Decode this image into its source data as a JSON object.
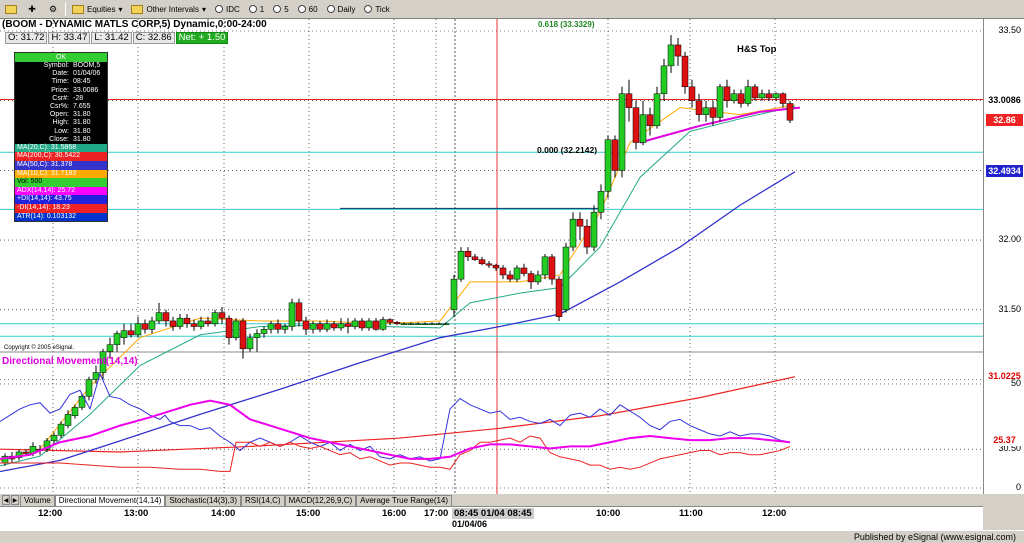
{
  "toolbar": {
    "equities": "Equities",
    "other_intervals": "Other Intervals",
    "idc": "IDC",
    "i1": "1",
    "i5": "5",
    "i60": "60",
    "daily": "Daily",
    "tick": "Tick"
  },
  "chart": {
    "title": "(BOOM - DYNAMIC MATLS CORP,5) Dynamic,0:00-24:00",
    "ohlc": {
      "open": "O: 31.72",
      "high": "H: 33.47",
      "low": "L: 31.42",
      "close": "C: 32.86",
      "net": "Net: + 1.50"
    },
    "fib_label": "0.618 (33.3329)",
    "zero_label": "0.000 (32.2142)",
    "pattern_label": "H&S Top",
    "copyright": "Copyright © 2005 eSignal.",
    "indicator_title": "Directional Movement(14,14)"
  },
  "data_box": {
    "ok": "OK",
    "rows": [
      {
        "label": "Symbol:",
        "value": "BOOM,5"
      },
      {
        "label": "Date:",
        "value": "01/04/06"
      },
      {
        "label": "Time:",
        "value": "08:45"
      },
      {
        "label": "Price:",
        "value": "33.0086"
      },
      {
        "label": "Csr#:",
        "value": "-28"
      },
      {
        "label": "Csr%:",
        "value": "7.655"
      },
      {
        "label": "Open:",
        "value": "31.80"
      },
      {
        "label": "High:",
        "value": "31.80"
      },
      {
        "label": "Low:",
        "value": "31.80"
      },
      {
        "label": "Close:",
        "value": "31.80"
      }
    ],
    "study_rows": [
      {
        "text": "MA(20,C): 31.5868",
        "bg": "#22aa88",
        "fg": "#fff"
      },
      {
        "text": "MA(200,C): 30.5422",
        "bg": "#ee2222",
        "fg": "#fff"
      },
      {
        "text": "MA(50,C): 31.378",
        "bg": "#3333cc",
        "fg": "#fff"
      },
      {
        "text": "MA(10,C): 31.7183",
        "bg": "#ffaa00",
        "fg": "#fff"
      },
      {
        "text": "Vol: 500",
        "bg": "#33cc33",
        "fg": "#000"
      },
      {
        "text": "ADX(14,14): 25.72",
        "bg": "#ff00ff",
        "fg": "#fff"
      },
      {
        "text": "+DI(14,14): 43.75",
        "bg": "#2222dd",
        "fg": "#fff"
      },
      {
        "text": "-DI(14,14): 18.23",
        "bg": "#ee2222",
        "fg": "#fff"
      },
      {
        "text": "ATR(14): 0.103132",
        "bg": "#0033cc",
        "fg": "#fff"
      }
    ]
  },
  "price_axis": {
    "labels": [
      "33.50",
      "33.00",
      "32.50",
      "32.00",
      "31.50",
      "31.00",
      "30.50"
    ],
    "tags": [
      {
        "text": "33.0086",
        "bg": "#ffffff",
        "fg": "#000"
      },
      {
        "text": "32.86",
        "bg": "#ee2222",
        "fg": "#fff"
      },
      {
        "text": "32.4934",
        "bg": "#2222cc",
        "fg": "#fff"
      },
      {
        "text": "31.0225",
        "bg": "#ffffff",
        "fg": "#dd0000"
      }
    ]
  },
  "indicator_axis": {
    "labels": [
      "50",
      "25",
      "0"
    ],
    "tag": "25.37"
  },
  "tabs": [
    "Volume",
    "Directional Movement(14,14)",
    "Stochastic(14(3),3)",
    "RSI(14,C)",
    "MACD(12,26,9,C)",
    "Average True Range(14)"
  ],
  "time_axis": {
    "labels": [
      "12:00",
      "13:00",
      "14:00",
      "15:00",
      "16:00",
      "17:00",
      "10:00",
      "11:00",
      "12:00"
    ],
    "cursor": "08:45 01/04 08:45",
    "date": "01/04/06"
  },
  "status": "Published by eSignal (www.esignal.com)",
  "colors": {
    "ma10": "#ffaa00",
    "ma20": "#22aa88",
    "ma50": "#3333cc",
    "ma200": "#ee2222",
    "adx": "#ff00ff",
    "pdi": "#3333dd",
    "mdi": "#ee2222"
  }
}
